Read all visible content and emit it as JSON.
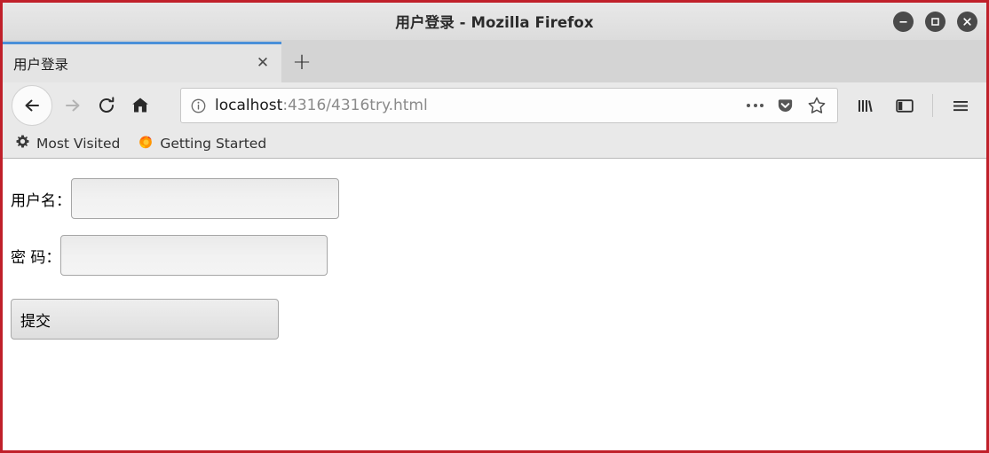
{
  "window": {
    "title": "用户登录 - Mozilla Firefox",
    "controls": {
      "minimize_label": "minimize",
      "maximize_label": "maximize",
      "close_label": "close"
    },
    "frame_color": "#c0202a"
  },
  "tabs": {
    "items": [
      {
        "label": "用户登录",
        "close_glyph": "✕",
        "active": true
      }
    ],
    "new_tab_glyph": "+",
    "active_indicator_color": "#4a90d9"
  },
  "toolbar": {
    "back_label": "Back",
    "forward_label": "Forward",
    "reload_label": "Reload",
    "home_label": "Home",
    "library_label": "Library",
    "sidebar_label": "Sidebar",
    "menu_label": "Open menu"
  },
  "urlbar": {
    "host": "localhost",
    "path": ":4316/4316try.html",
    "full_url": "localhost:4316/4316try.html",
    "info_label": "Site information",
    "page_actions_label": "Page actions",
    "pocket_label": "Save to Pocket",
    "bookmark_label": "Bookmark this page"
  },
  "bookmarks": {
    "items": [
      {
        "label": "Most Visited",
        "icon": "gear-icon"
      },
      {
        "label": "Getting Started",
        "icon": "firefox-logo-icon"
      }
    ]
  },
  "page": {
    "form": {
      "username": {
        "label": "用户名：",
        "value": "",
        "placeholder": ""
      },
      "password": {
        "label": "密 码：",
        "value": "",
        "placeholder": ""
      },
      "submit_label": "提交"
    }
  }
}
